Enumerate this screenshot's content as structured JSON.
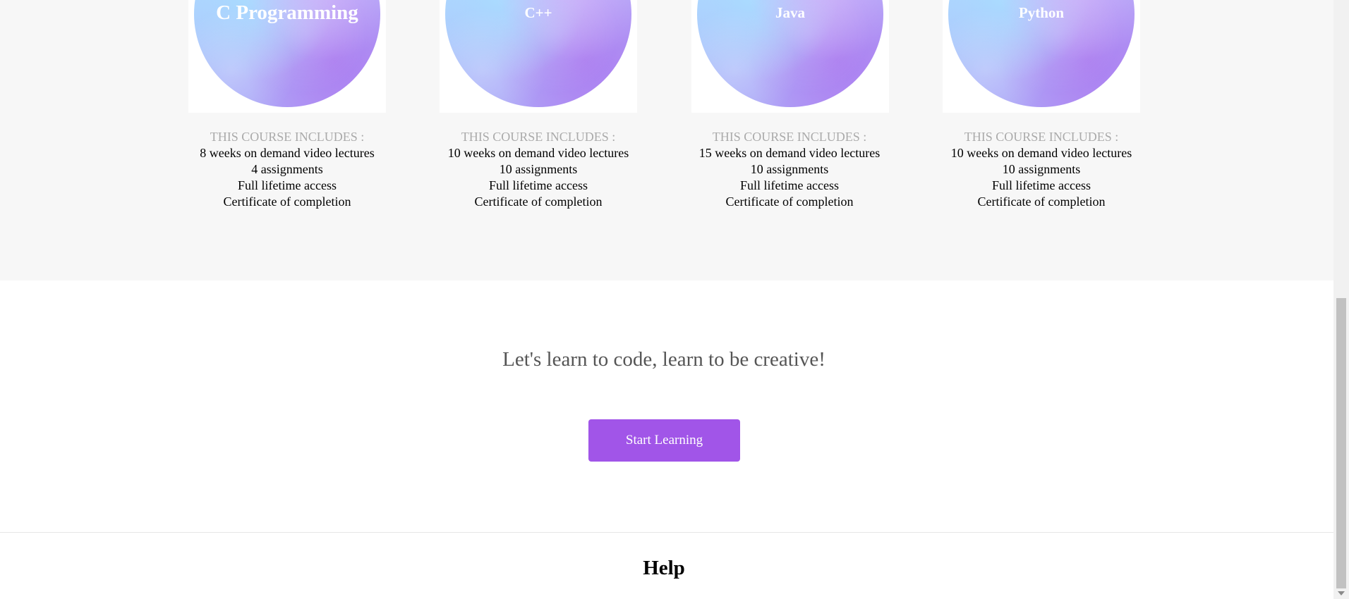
{
  "courses": [
    {
      "title": "C Programming",
      "includes_heading": "THIS COURSE INCLUDES :",
      "features": [
        "8 weeks on demand video lectures",
        "4 assignments",
        "Full lifetime access",
        "Certificate of completion"
      ]
    },
    {
      "title": "C++",
      "includes_heading": "THIS COURSE INCLUDES :",
      "features": [
        "10 weeks on demand video lectures",
        "10 assignments",
        "Full lifetime access",
        "Certificate of completion"
      ]
    },
    {
      "title": "Java",
      "includes_heading": "THIS COURSE INCLUDES :",
      "features": [
        "15 weeks on demand video lectures",
        "10 assignments",
        "Full lifetime access",
        "Certificate of completion"
      ]
    },
    {
      "title": "Python",
      "includes_heading": "THIS COURSE INCLUDES :",
      "features": [
        "10 weeks on demand video lectures",
        "10 assignments",
        "Full lifetime access",
        "Certificate of completion"
      ]
    }
  ],
  "cta": {
    "tagline": "Let's learn to code, learn to be creative!",
    "button_label": "Start Learning"
  },
  "footer": {
    "help_heading": "Help"
  },
  "colors": {
    "accent": "#a155e8",
    "section_bg": "#f7f7f7",
    "muted_text": "#aaaaaa",
    "tagline_text": "#555555"
  }
}
